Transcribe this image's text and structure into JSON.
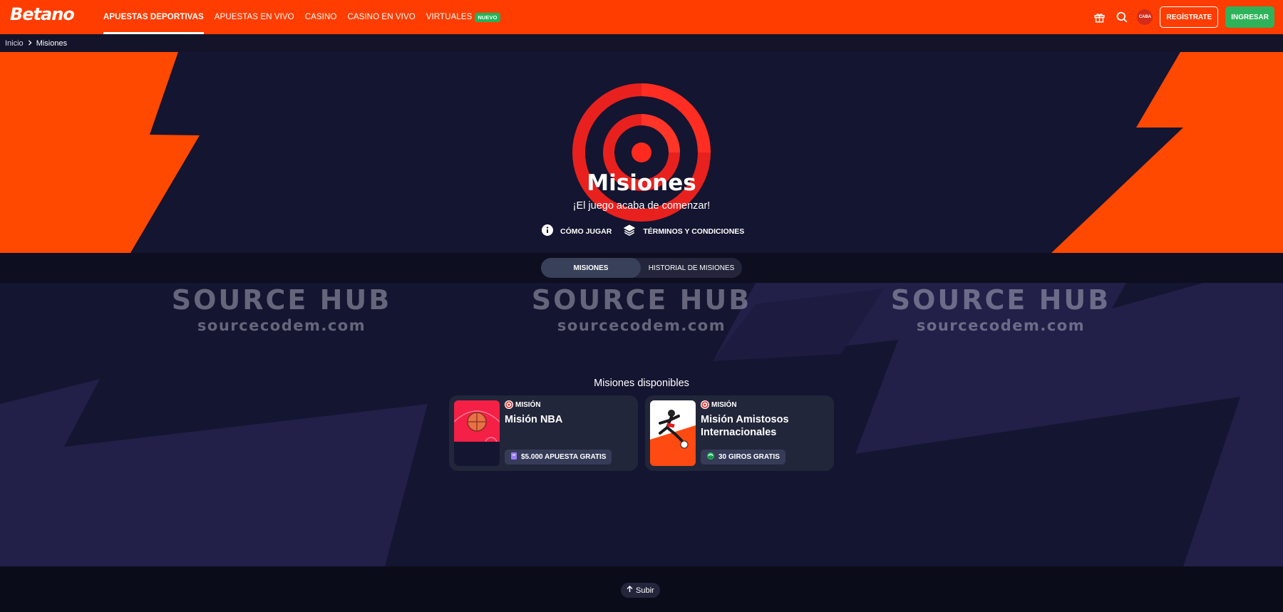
{
  "brand": {
    "logo_text": "Betano",
    "accent": "#ff3d00"
  },
  "nav": {
    "items": [
      {
        "label": "APUESTAS DEPORTIVAS",
        "active": true
      },
      {
        "label": "APUESTAS EN VIVO"
      },
      {
        "label": "CASINO"
      },
      {
        "label": "CASINO EN VIVO"
      },
      {
        "label": "VIRTUALES",
        "badge": "NUEVO"
      }
    ]
  },
  "header_actions": {
    "gift_icon": "gift-icon",
    "search_icon": "search-icon",
    "region": "CABA",
    "register_label": "REGÍSTRATE",
    "login_label": "INGRESAR"
  },
  "breadcrumb": {
    "home": "Inicio",
    "current": "Misiones"
  },
  "hero": {
    "title": "Misiones",
    "subtitle": "¡El juego acaba de comenzar!",
    "links": [
      {
        "label": "CÓMO JUGAR",
        "icon": "info-icon"
      },
      {
        "label": "TÉRMINOS Y CONDICIONES",
        "icon": "layers-icon"
      }
    ]
  },
  "tabs": [
    {
      "label": "MISIONES",
      "active": true
    },
    {
      "label": "HISTORIAL DE MISIONES"
    }
  ],
  "watermarks": [
    {
      "title": "SOURCE HUB",
      "site": "sourcecodem.com"
    },
    {
      "title": "SOURCE HUB",
      "site": "sourcecodem.com"
    },
    {
      "title": "SOURCE HUB",
      "site": "sourcecodem.com"
    }
  ],
  "missions": {
    "section_title": "Misiones disponibles",
    "cards": [
      {
        "kicker": "MISIÓN",
        "title": "Misión NBA",
        "reward": "$5.000 APUESTA GRATIS",
        "reward_icon": "ticket-icon"
      },
      {
        "kicker": "MISIÓN",
        "title": "Misión Amistosos Internacionales",
        "reward": "30 GIROS GRATIS",
        "reward_icon": "spin-icon"
      }
    ]
  },
  "footer": {
    "scroll_top_label": "Subir"
  }
}
